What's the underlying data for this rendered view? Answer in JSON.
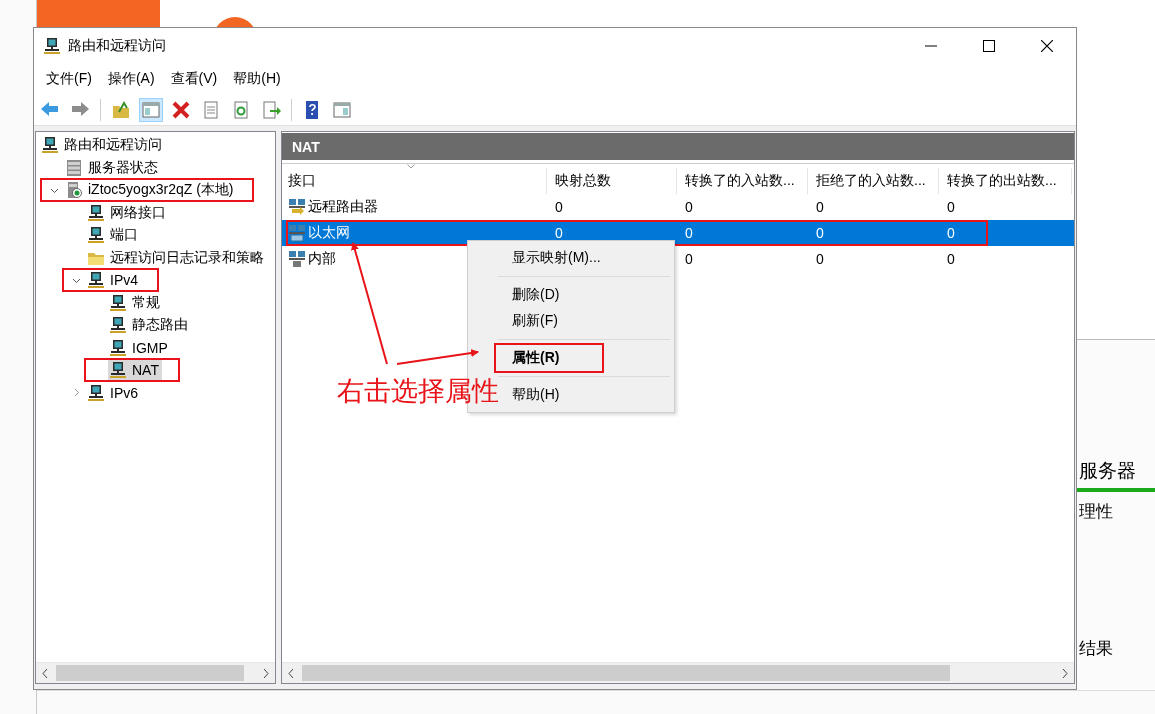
{
  "window": {
    "title": "路由和远程访问"
  },
  "menu_bar": [
    "文件(F)",
    "操作(A)",
    "查看(V)",
    "帮助(H)"
  ],
  "toolbar": [
    {
      "kind": "back",
      "pressed": false
    },
    {
      "kind": "forward",
      "pressed": false
    },
    {
      "kind": "separator"
    },
    {
      "kind": "up",
      "pressed": false
    },
    {
      "kind": "tree-toggle",
      "pressed": true
    },
    {
      "kind": "delete",
      "pressed": false
    },
    {
      "kind": "properties",
      "pressed": false
    },
    {
      "kind": "refresh",
      "pressed": false
    },
    {
      "kind": "export",
      "pressed": false
    },
    {
      "kind": "separator"
    },
    {
      "kind": "help",
      "pressed": false
    },
    {
      "kind": "action-pane",
      "pressed": false
    }
  ],
  "tree": {
    "label": "路由和远程访问",
    "kind": "router",
    "selected": false,
    "highlighted": false,
    "children": [
      {
        "label": "服务器状态",
        "kind": "server",
        "selected": false,
        "highlighted": false
      },
      {
        "label": "iZtoc5yogx3r2qZ (本地)",
        "kind": "server-local",
        "expanded": true,
        "selected": false,
        "highlighted": true,
        "children": [
          {
            "label": "网络接口",
            "kind": "router",
            "selected": false,
            "highlighted": false
          },
          {
            "label": "端口",
            "kind": "router",
            "selected": false,
            "highlighted": false
          },
          {
            "label": "远程访问日志记录和策略",
            "kind": "folder",
            "selected": false,
            "highlighted": false
          },
          {
            "label": "IPv4",
            "kind": "router",
            "expanded": true,
            "selected": false,
            "highlighted": true,
            "children": [
              {
                "label": "常规",
                "kind": "router",
                "selected": false,
                "highlighted": false
              },
              {
                "label": "静态路由",
                "kind": "router",
                "selected": false,
                "highlighted": false
              },
              {
                "label": "IGMP",
                "kind": "router",
                "selected": false,
                "highlighted": false
              },
              {
                "label": "NAT",
                "kind": "router",
                "selected": true,
                "highlighted": true
              }
            ]
          },
          {
            "label": "IPv6",
            "kind": "router",
            "expanded": false,
            "selected": false,
            "highlighted": false
          }
        ]
      }
    ]
  },
  "pane": {
    "title": "NAT",
    "columns": [
      "接口",
      "映射总数",
      "转换了的入站数...",
      "拒绝了的入站数...",
      "转换了的出站数..."
    ],
    "rows": [
      {
        "kind": "remote",
        "cells": [
          "远程路由器",
          "0",
          "0",
          "0",
          "0"
        ],
        "selected": false,
        "highlighted": false
      },
      {
        "kind": "ethernet",
        "cells": [
          "以太网",
          "0",
          "0",
          "0",
          "0"
        ],
        "selected": true,
        "highlighted": true
      },
      {
        "kind": "internal",
        "cells": [
          "内部",
          null,
          "0",
          "0",
          "0"
        ],
        "selected": false,
        "highlighted": false
      }
    ]
  },
  "context_menu": {
    "items": [
      {
        "kind": "item",
        "label": "显示映射(M)...",
        "bold": false,
        "highlighted": false
      },
      {
        "kind": "separator"
      },
      {
        "kind": "item",
        "label": "删除(D)",
        "bold": false,
        "highlighted": false
      },
      {
        "kind": "item",
        "label": "刷新(F)",
        "bold": false,
        "highlighted": false
      },
      {
        "kind": "separator"
      },
      {
        "kind": "item",
        "label": "属性(R)",
        "bold": true,
        "highlighted": true
      },
      {
        "kind": "separator"
      },
      {
        "kind": "item",
        "label": "帮助(H)",
        "bold": false,
        "highlighted": false
      }
    ]
  },
  "annotation": {
    "text": "右击选择属性"
  },
  "background_window": {
    "tab": {
      "label": "服务器",
      "selected": true
    },
    "line_1": "理性",
    "line_2": "结果"
  }
}
